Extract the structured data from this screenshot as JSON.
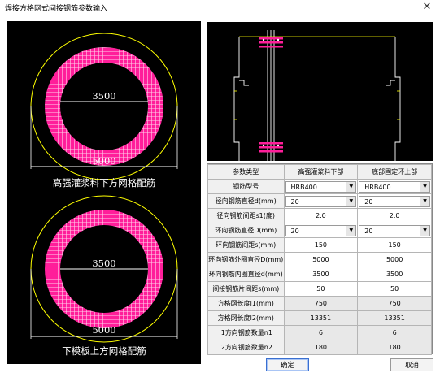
{
  "window": {
    "title": "焊接方格网式间接钢筋参数输入",
    "close_icon": "close-icon"
  },
  "left": {
    "top_ring": {
      "inner_label": "3500",
      "outer_label": "5000",
      "caption": "高强灌浆料下方网格配筋"
    },
    "bottom_ring": {
      "inner_label": "3500",
      "outer_label": "5000",
      "caption": "下模板上方网格配筋"
    },
    "colors": {
      "ring": "#ff1e9a",
      "circle": "#ffff00",
      "bg": "#000000"
    }
  },
  "table": {
    "headers": [
      "参数类型",
      "高强灌浆料下部",
      "底部固定环上部"
    ],
    "rows": [
      {
        "label": "钢筋型号",
        "col1": "HRB400",
        "col2": "HRB400",
        "type": "select"
      },
      {
        "label": "径向钢筋直径d(mm)",
        "col1": "20",
        "col2": "20",
        "type": "select"
      },
      {
        "label": "径向钢筋间距s1(度)",
        "col1": "2.0",
        "col2": "2.0",
        "type": "input"
      },
      {
        "label": "环向钢筋直径D(mm)",
        "col1": "20",
        "col2": "20",
        "type": "select"
      },
      {
        "label": "环向钢筋间距s(mm)",
        "col1": "150",
        "col2": "150",
        "type": "input"
      },
      {
        "label": "环向钢筋外圈直径D(mm)",
        "col1": "5000",
        "col2": "5000",
        "type": "input"
      },
      {
        "label": "环向钢筋内圈直径d(mm)",
        "col1": "3500",
        "col2": "3500",
        "type": "input"
      },
      {
        "label": "间接钢筋片间距s(mm)",
        "col1": "50",
        "col2": "50",
        "type": "input"
      },
      {
        "label": "方格网长度l1(mm)",
        "col1": "750",
        "col2": "750",
        "type": "readonly"
      },
      {
        "label": "方格网长度l2(mm)",
        "col1": "13351",
        "col2": "13351",
        "type": "readonly"
      },
      {
        "label": "l1方向钢筋数量n1",
        "col1": "6",
        "col2": "6",
        "type": "readonly"
      },
      {
        "label": "l2方向钢筋数量n2",
        "col1": "180",
        "col2": "180",
        "type": "readonly"
      }
    ]
  },
  "buttons": {
    "ok": "确定",
    "cancel": "取消"
  }
}
